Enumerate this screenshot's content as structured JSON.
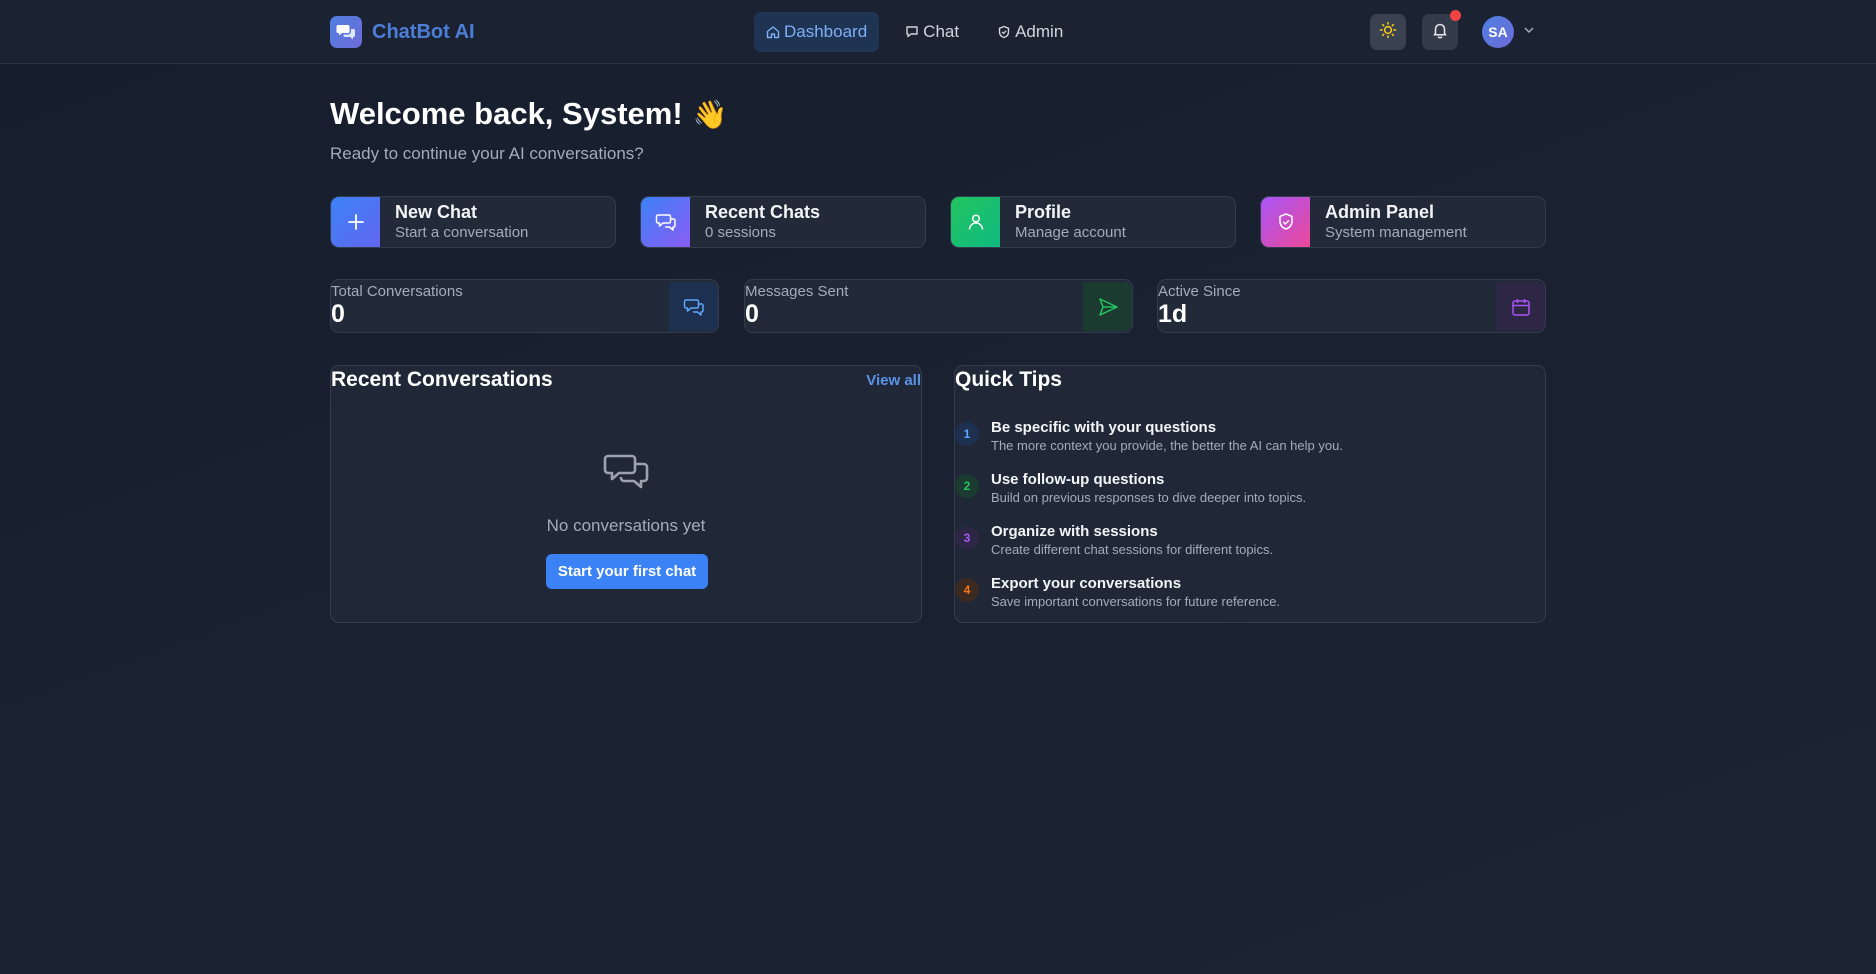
{
  "header": {
    "brand_name": "ChatBot AI",
    "nav": [
      {
        "label": "Dashboard",
        "icon": "home-icon",
        "active": true
      },
      {
        "label": "Chat",
        "icon": "chat-icon",
        "active": false
      },
      {
        "label": "Admin",
        "icon": "shield-icon",
        "active": false
      }
    ],
    "avatar_initials": "SA"
  },
  "welcome": {
    "title": "Welcome back, System!",
    "emoji": "👋",
    "subtitle": "Ready to continue your AI conversations?"
  },
  "quick_actions": [
    {
      "title": "New Chat",
      "subtitle": "Start a conversation",
      "icon": "plus-icon"
    },
    {
      "title": "Recent Chats",
      "subtitle": "0 sessions",
      "icon": "chat-icon"
    },
    {
      "title": "Profile",
      "subtitle": "Manage account",
      "icon": "user-icon"
    },
    {
      "title": "Admin Panel",
      "subtitle": "System management",
      "icon": "shield-icon"
    }
  ],
  "stats": [
    {
      "label": "Total Conversations",
      "value": "0",
      "icon": "chat-icon"
    },
    {
      "label": "Messages Sent",
      "value": "0",
      "icon": "send-icon"
    },
    {
      "label": "Active Since",
      "value": "1d",
      "icon": "calendar-icon"
    }
  ],
  "recent": {
    "title": "Recent Conversations",
    "view_all": "View all",
    "empty_text": "No conversations yet",
    "start_button": "Start your first chat"
  },
  "tips": {
    "title": "Quick Tips",
    "items": [
      {
        "num": "1",
        "title": "Be specific with your questions",
        "desc": "The more context you provide, the better the AI can help you."
      },
      {
        "num": "2",
        "title": "Use follow-up questions",
        "desc": "Build on previous responses to dive deeper into topics."
      },
      {
        "num": "3",
        "title": "Organize with sessions",
        "desc": "Create different chat sessions for different topics."
      },
      {
        "num": "4",
        "title": "Export your conversations",
        "desc": "Save important conversations for future reference."
      }
    ]
  },
  "colors": {
    "accent": "#3b82f6",
    "brand": "#4c7ed8",
    "notification": "#ef4444",
    "tip_1": "#60a5fa",
    "tip_2": "#22c55e",
    "tip_3": "#a855f7",
    "tip_4": "#f97316"
  }
}
